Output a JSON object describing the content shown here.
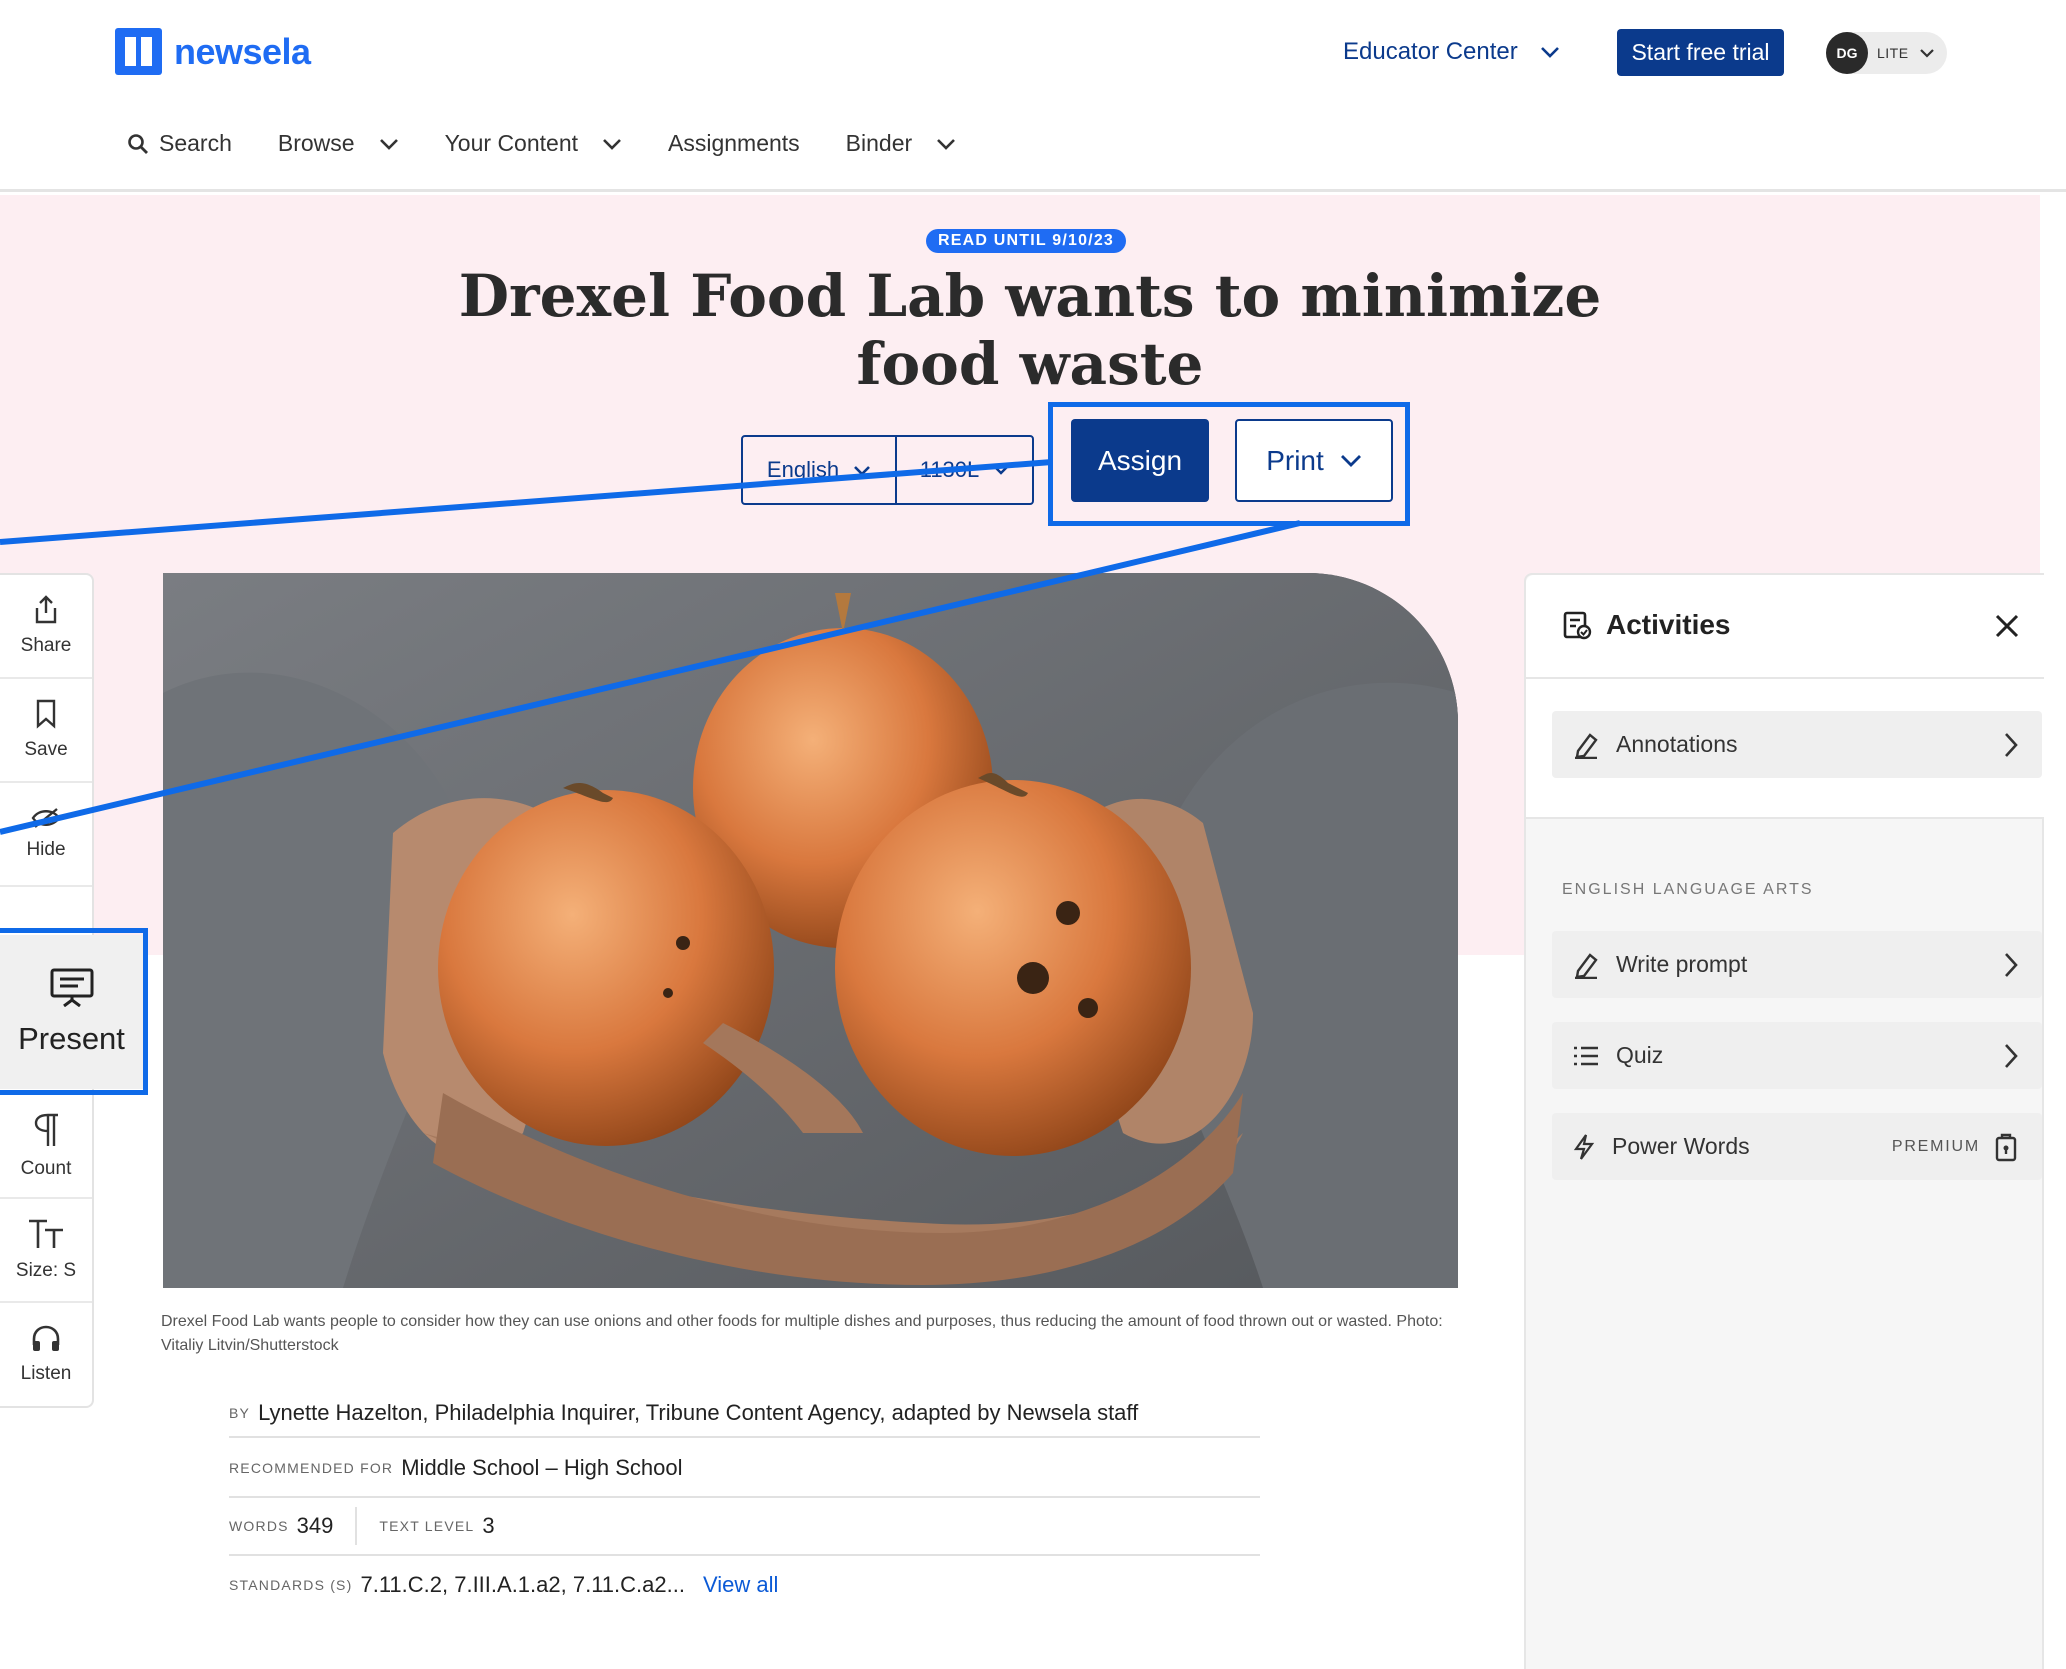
{
  "header": {
    "logo_text": "newsela",
    "educator_center": "Educator Center",
    "trial_button": "Start free trial",
    "avatar_initials": "DG",
    "plan_label": "LITE"
  },
  "nav": {
    "search": "Search",
    "browse": "Browse",
    "your_content": "Your Content",
    "assignments": "Assignments",
    "binder": "Binder"
  },
  "article": {
    "read_until": "READ UNTIL 9/10/23",
    "title": "Drexel Food Lab wants to minimize food waste",
    "language": "English",
    "lexile": "1130L",
    "assign_label": "Assign",
    "print_label": "Print",
    "caption": "Drexel Food Lab wants people to consider how they can use onions and other foods for multiple dishes and purposes, thus reducing the amount of food thrown out or wasted. Photo: Vitaliy Litvin/Shutterstock"
  },
  "toolbar": {
    "share": "Share",
    "save": "Save",
    "hide": "Hide",
    "present": "Present",
    "count": "Count",
    "size": "Size: S",
    "listen": "Listen"
  },
  "meta": {
    "by_label": "BY",
    "by_value": "Lynette Hazelton, Philadelphia Inquirer, Tribune Content Agency, adapted by Newsela staff",
    "recommended_label": "RECOMMENDED FOR",
    "recommended_value": "Middle School – High School",
    "words_label": "WORDS",
    "words_value": "349",
    "text_level_label": "TEXT LEVEL",
    "text_level_value": "3",
    "standards_label": "STANDARDS (S)",
    "standards_value": "7.11.C.2, 7.III.A.1.a2, 7.11.C.a2...",
    "view_all": "View all"
  },
  "activities": {
    "title": "Activities",
    "annotations": "Annotations",
    "section_label": "ENGLISH LANGUAGE ARTS",
    "write_prompt": "Write prompt",
    "quiz": "Quiz",
    "power_words": "Power Words",
    "premium": "PREMIUM"
  },
  "colors": {
    "brand_blue": "#1f6cf3",
    "navy": "#0b3a8c",
    "highlight": "#0f6ae8",
    "hero_pink": "#fdeef2"
  }
}
